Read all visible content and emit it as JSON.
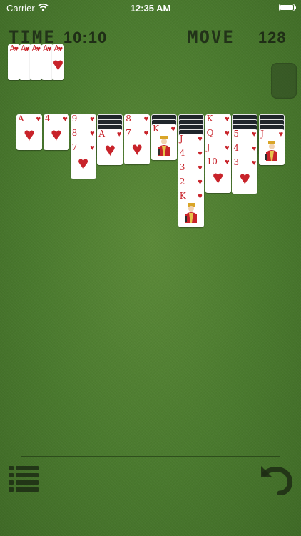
{
  "status_bar": {
    "carrier": "Carrier",
    "time": "12:35 AM"
  },
  "header": {
    "time_label": "TIME",
    "time_value": "10:10",
    "move_label": "MOVE",
    "move_value": "128"
  },
  "colors": {
    "felt": "#4a7a2e",
    "card_red": "#c8232a",
    "card_back": "#20262b"
  },
  "foundation": [
    {
      "rank": "A",
      "suit": "♥"
    },
    {
      "rank": "A",
      "suit": "♥"
    },
    {
      "rank": "A",
      "suit": "♥"
    },
    {
      "rank": "A",
      "suit": "♥"
    },
    {
      "rank": "A",
      "suit": "♥"
    }
  ],
  "tableau": [
    {
      "column": 1,
      "face_down": 0,
      "cards": [
        {
          "rank": "A",
          "suit": "♥"
        }
      ]
    },
    {
      "column": 2,
      "face_down": 0,
      "cards": [
        {
          "rank": "4",
          "suit": "♥"
        }
      ]
    },
    {
      "column": 3,
      "face_down": 0,
      "cards": [
        {
          "rank": "9",
          "suit": "♥"
        },
        {
          "rank": "8",
          "suit": "♥"
        },
        {
          "rank": "7",
          "suit": "♥"
        }
      ]
    },
    {
      "column": 4,
      "face_down": 3,
      "cards": [
        {
          "rank": "A",
          "suit": "♥"
        }
      ]
    },
    {
      "column": 5,
      "face_down": 0,
      "cards": [
        {
          "rank": "8",
          "suit": "♥"
        },
        {
          "rank": "7",
          "suit": "♥"
        }
      ]
    },
    {
      "column": 6,
      "face_down": 2,
      "cards": [
        {
          "rank": "K",
          "suit": "♥",
          "face": true
        }
      ]
    },
    {
      "column": 7,
      "face_down": 4,
      "cards": [
        {
          "rank": "J",
          "suit": "♥",
          "face": true
        },
        {
          "rank": "4",
          "suit": "♥"
        },
        {
          "rank": "3",
          "suit": "♥"
        },
        {
          "rank": "2",
          "suit": "♥"
        },
        {
          "rank": "K",
          "suit": "♥",
          "face": true
        }
      ]
    },
    {
      "column": 8,
      "face_down": 0,
      "cards": [
        {
          "rank": "K",
          "suit": "♥",
          "face": true
        },
        {
          "rank": "Q",
          "suit": "♥",
          "face": true
        },
        {
          "rank": "J",
          "suit": "♥",
          "face": true
        },
        {
          "rank": "10",
          "suit": "♥"
        }
      ]
    },
    {
      "column": 9,
      "face_down": 3,
      "cards": [
        {
          "rank": "5",
          "suit": "♥"
        },
        {
          "rank": "4",
          "suit": "♥"
        },
        {
          "rank": "3",
          "suit": "♥"
        }
      ]
    },
    {
      "column": 10,
      "face_down": 3,
      "cards": [
        {
          "rank": "J",
          "suit": "♥",
          "face": true
        }
      ]
    }
  ],
  "controls": {
    "menu_icon": "menu-icon",
    "undo_icon": "undo-icon"
  }
}
